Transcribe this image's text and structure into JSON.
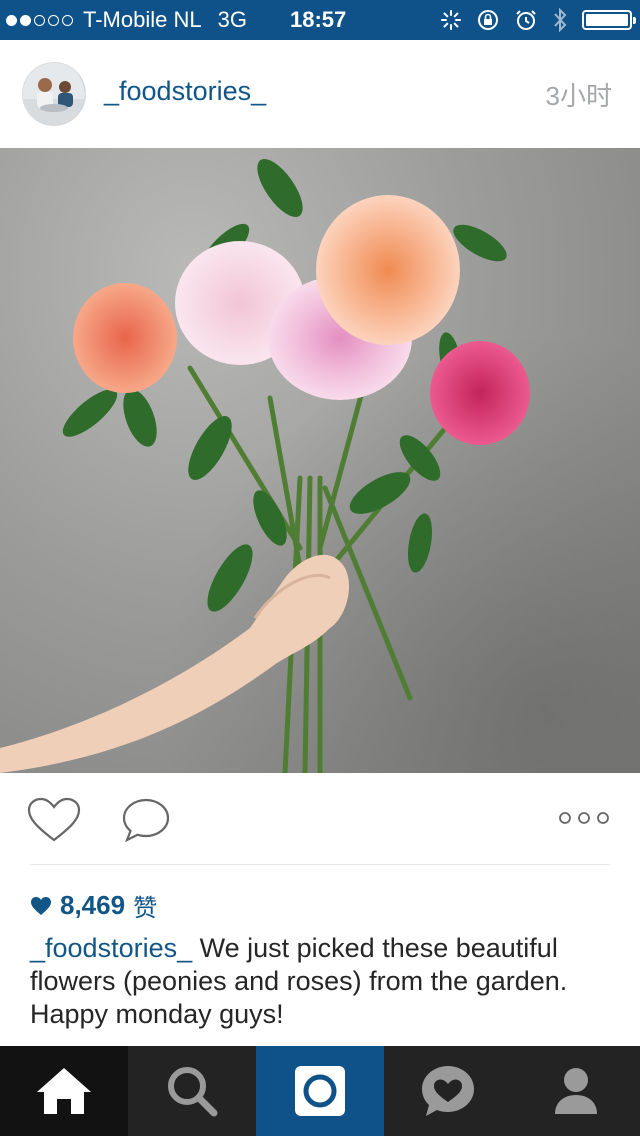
{
  "status_bar": {
    "carrier": "T-Mobile NL",
    "network": "3G",
    "time": "18:57",
    "signal_bars_filled": 2,
    "signal_bars_total": 5,
    "icons": [
      "activity-icon",
      "rotation-lock-icon",
      "alarm-icon",
      "bluetooth-icon",
      "battery-icon"
    ],
    "battery_level": 1.0
  },
  "post": {
    "username": "_foodstories_",
    "timestamp": "3小时",
    "photo_icon": "flower-bouquet-photo"
  },
  "actions": {
    "like_icon": "heart-outline-icon",
    "comment_icon": "comment-bubble-icon",
    "more_icon": "more-dots-icon"
  },
  "likes": {
    "count": "8,469",
    "suffix": "赞"
  },
  "caption": {
    "author": "_foodstories_",
    "text": " We just picked these beautiful flowers (peonies and roses) from the garden. Happy monday guys!"
  },
  "tab_bar": {
    "tabs": [
      "home-icon",
      "search-icon",
      "camera-icon",
      "activity-heart-icon",
      "profile-icon"
    ],
    "active": "home-icon"
  },
  "colors": {
    "status_bar_bg": "#0f5289",
    "link_blue": "#125688",
    "tab_bar_bg": "#232323",
    "tab_active_camera_bg": "#0f5289"
  }
}
